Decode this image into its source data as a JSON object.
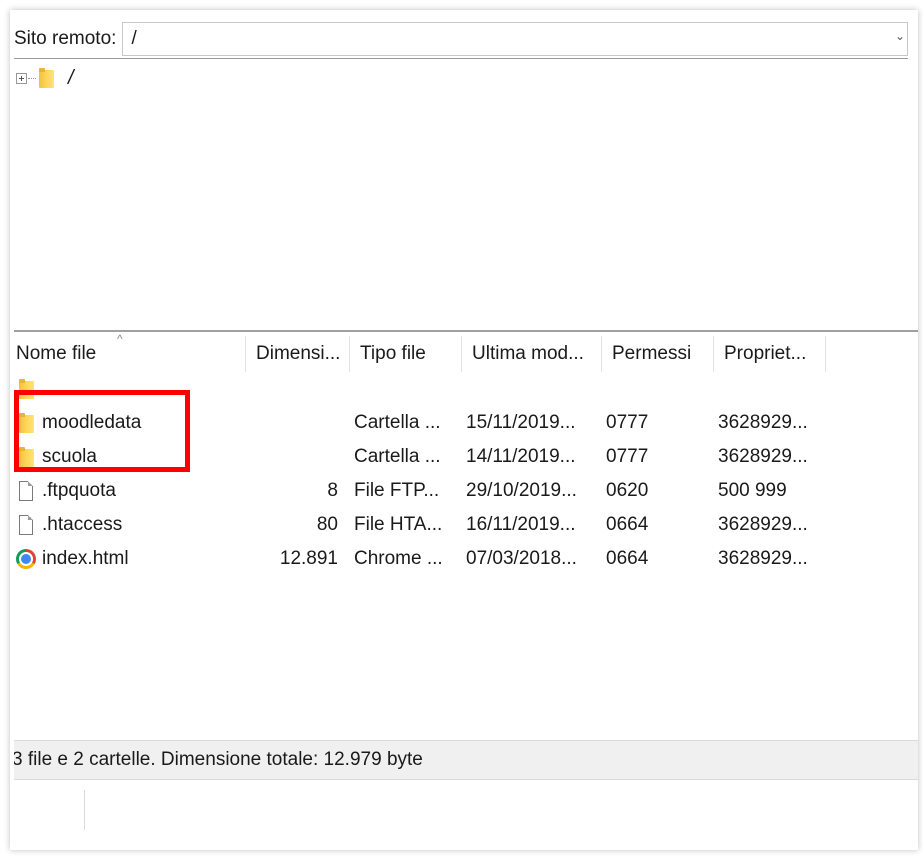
{
  "site_bar": {
    "label": "Sito remoto:",
    "path_value": "/"
  },
  "tree": {
    "root_label": "/"
  },
  "file_list": {
    "columns": [
      "Nome file",
      "Dimensi...",
      "Tipo file",
      "Ultima mod...",
      "Permessi",
      "Propriet..."
    ],
    "rows": [
      {
        "name": "..",
        "icon": "folder-icon",
        "size": "",
        "type": "",
        "modified": "",
        "permissions": "",
        "owner": ""
      },
      {
        "name": "moodledata",
        "icon": "folder-icon",
        "size": "",
        "type": "Cartella ...",
        "modified": "15/11/2019...",
        "permissions": "0777",
        "owner": "3628929..."
      },
      {
        "name": "scuola",
        "icon": "folder-icon",
        "size": "",
        "type": "Cartella ...",
        "modified": "14/11/2019...",
        "permissions": "0777",
        "owner": "3628929..."
      },
      {
        "name": ".ftpquota",
        "icon": "file-icon",
        "size": "8",
        "type": "File FTP...",
        "modified": "29/10/2019...",
        "permissions": "0620",
        "owner": "500 999"
      },
      {
        "name": ".htaccess",
        "icon": "file-icon",
        "size": "80",
        "type": "File HTA...",
        "modified": "16/11/2019...",
        "permissions": "0664",
        "owner": "3628929..."
      },
      {
        "name": "index.html",
        "icon": "chrome-icon",
        "size": "12.891",
        "type": "Chrome ...",
        "modified": "07/03/2018...",
        "permissions": "0664",
        "owner": "3628929..."
      }
    ]
  },
  "status_bar": {
    "text": "3 file e 2 cartelle. Dimensione totale: 12.979 byte"
  },
  "colors": {
    "highlight_border": "#ff0000",
    "folder": "#f6c945",
    "status_background": "#f0f0f0"
  }
}
